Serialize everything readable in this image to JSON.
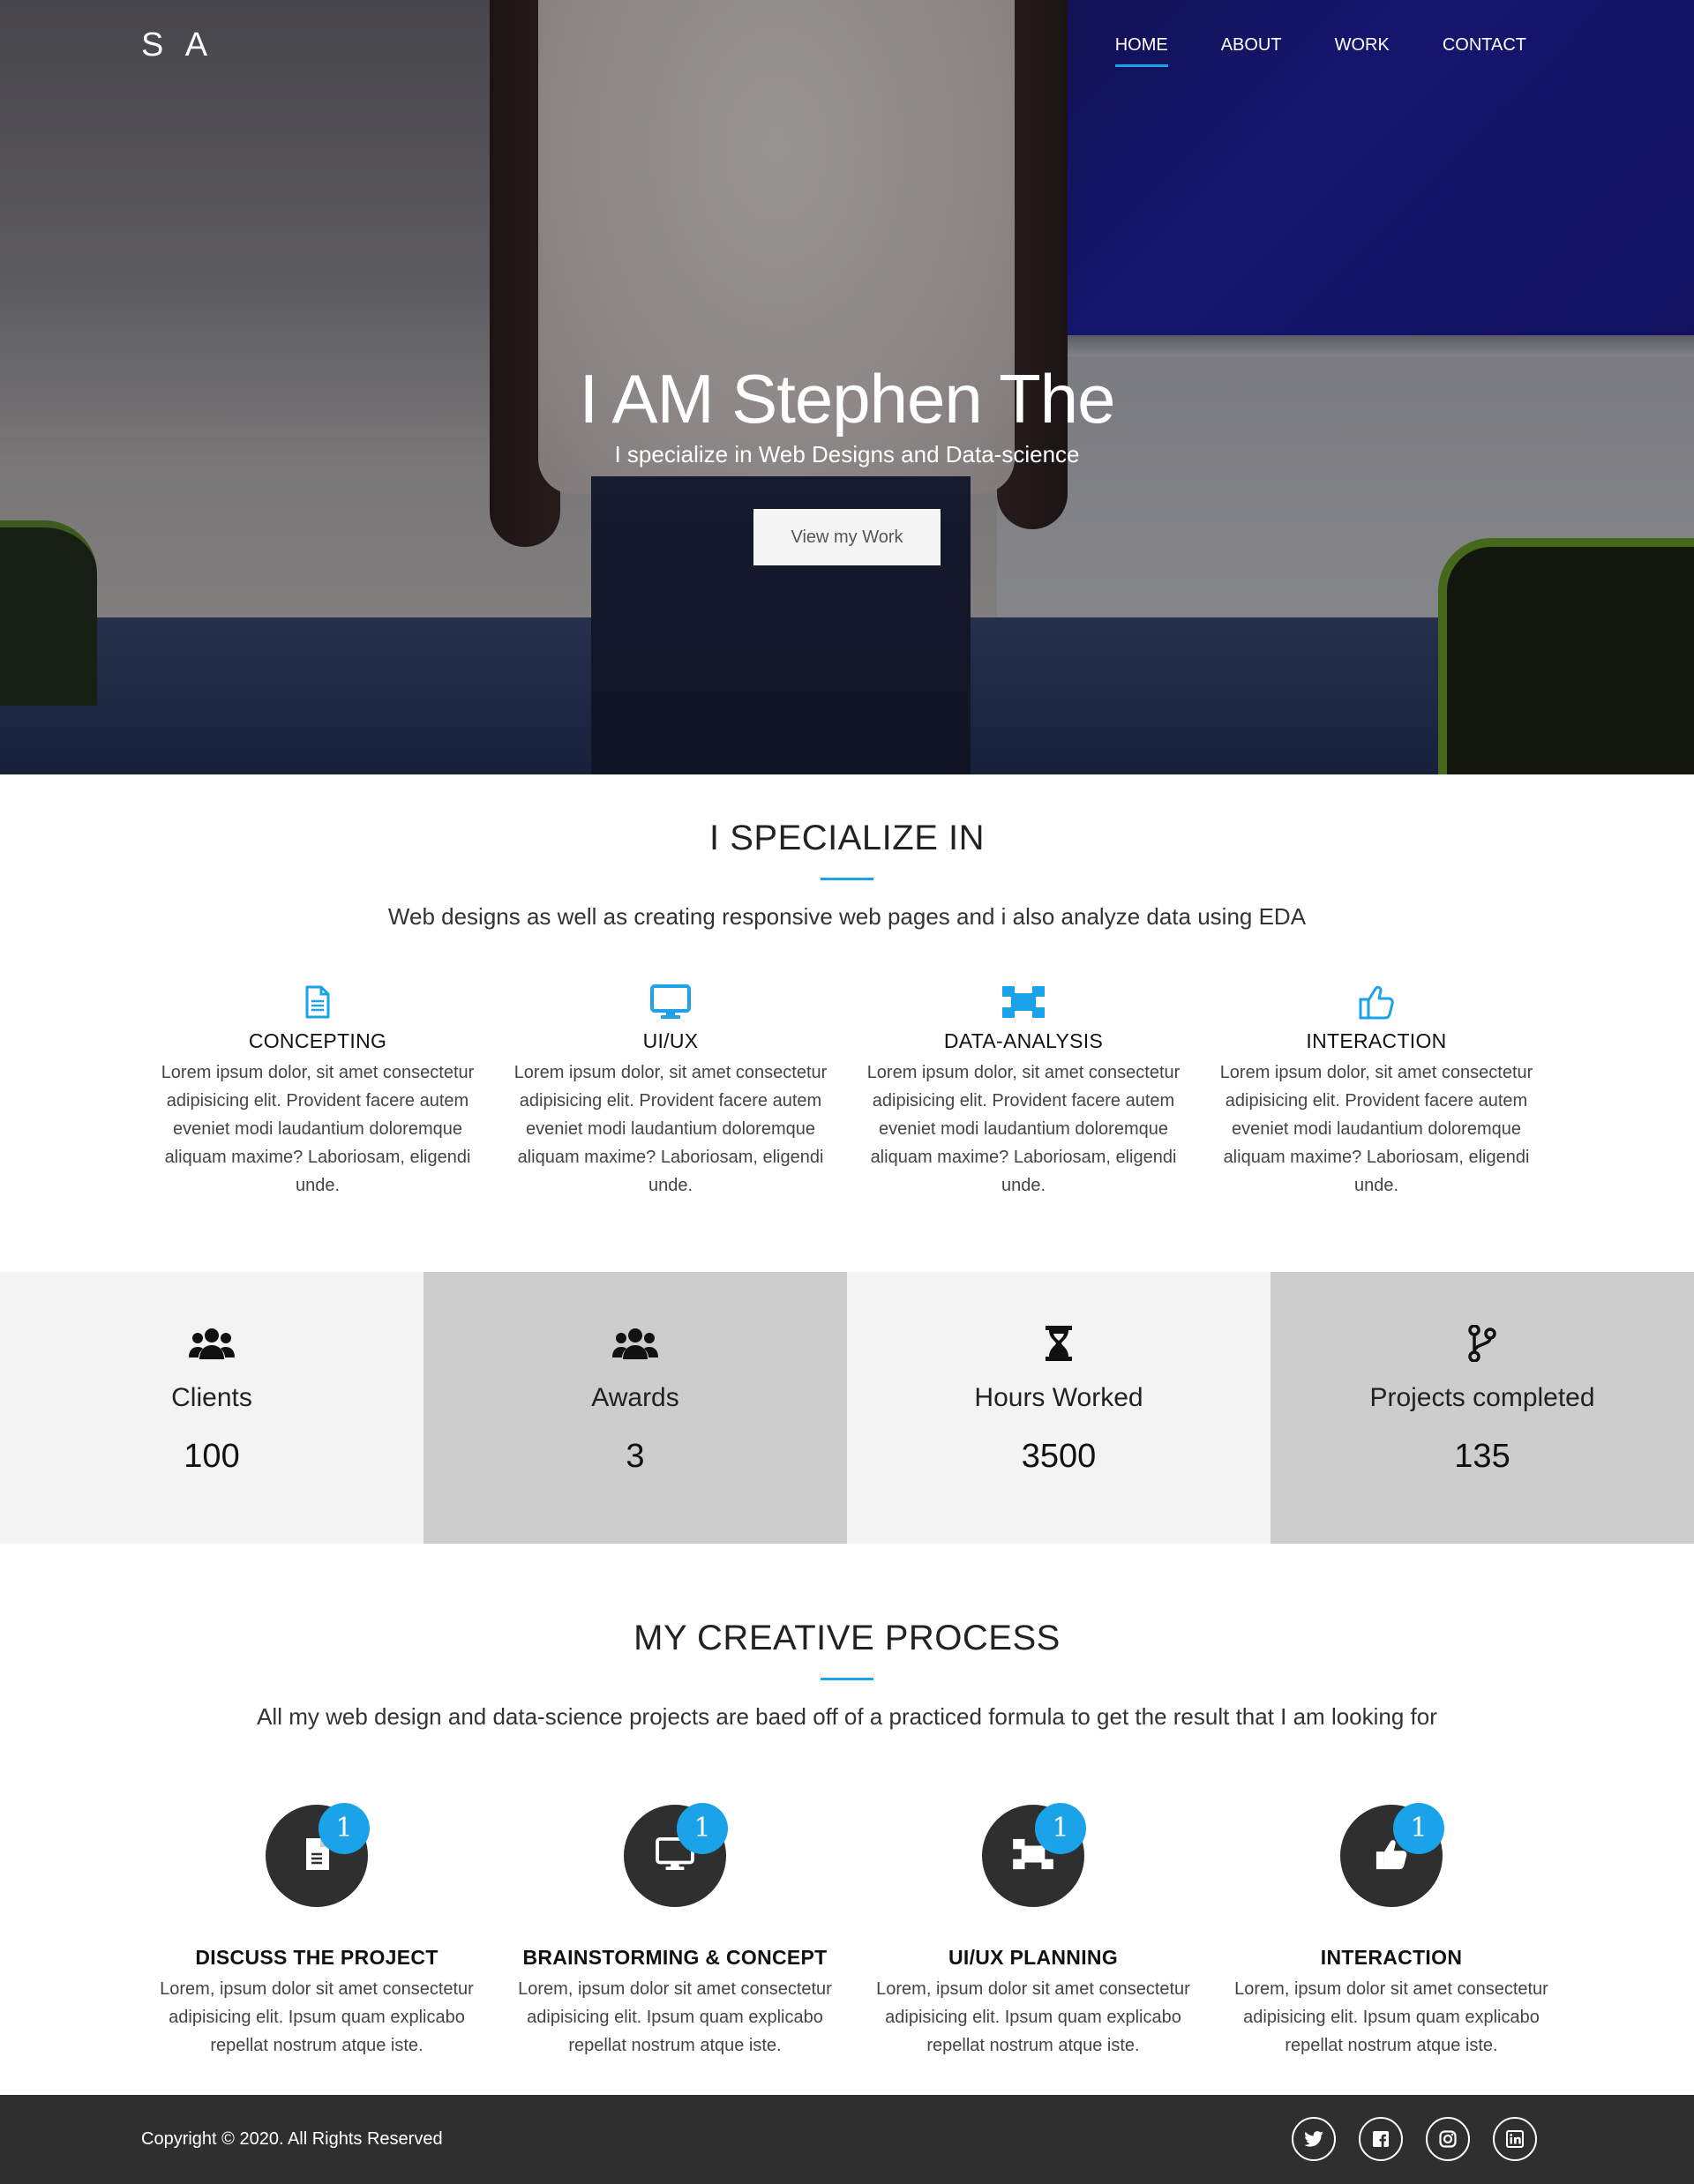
{
  "nav": {
    "logo": "S A",
    "items": [
      {
        "label": "HOME",
        "active": true
      },
      {
        "label": "ABOUT",
        "active": false
      },
      {
        "label": "WORK",
        "active": false
      },
      {
        "label": "CONTACT",
        "active": false
      }
    ]
  },
  "hero": {
    "title": "I AM Stephen The",
    "subtitle": "I specialize in Web Designs and Data-science",
    "button": "View my Work"
  },
  "specialize": {
    "title": "I SPECIALIZE IN",
    "subtitle": "Web designs as well as creating responsive web pages and i also analyze data using EDA",
    "items": [
      {
        "icon": "file-icon",
        "name": "CONCEPTING",
        "desc": "Lorem ipsum dolor, sit amet consectetur adipisicing elit. Provident facere autem eveniet modi laudantium doloremque aliquam maxime? Laboriosam, eligendi unde."
      },
      {
        "icon": "monitor-icon",
        "name": "UI/UX",
        "desc": "Lorem ipsum dolor, sit amet consectetur adipisicing elit. Provident facere autem eveniet modi laudantium doloremque aliquam maxime? Laboriosam, eligendi unde."
      },
      {
        "icon": "network-icon",
        "name": "DATA-ANALYSIS",
        "desc": "Lorem ipsum dolor, sit amet consectetur adipisicing elit. Provident facere autem eveniet modi laudantium doloremque aliquam maxime? Laboriosam, eligendi unde."
      },
      {
        "icon": "thumbs-up-icon",
        "name": "INTERACTION",
        "desc": "Lorem ipsum dolor, sit amet consectetur adipisicing elit. Provident facere autem eveniet modi laudantium doloremque aliquam maxime? Laboriosam, eligendi unde."
      }
    ]
  },
  "stats": [
    {
      "icon": "users-icon",
      "label": "Clients",
      "value": "100"
    },
    {
      "icon": "users-icon",
      "label": "Awards",
      "value": "3"
    },
    {
      "icon": "hourglass-icon",
      "label": "Hours Worked",
      "value": "3500"
    },
    {
      "icon": "code-branch-icon",
      "label": "Projects completed",
      "value": "135"
    }
  ],
  "process": {
    "title": "MY CREATIVE PROCESS",
    "subtitle": "All my web design and data-science projects are baed off of a practiced formula to get the result that I am looking for",
    "items": [
      {
        "icon": "file-icon",
        "badge": "1",
        "name": "DISCUSS THE PROJECT",
        "desc": "Lorem, ipsum dolor sit amet consectetur adipisicing elit. Ipsum quam explicabo repellat nostrum atque iste."
      },
      {
        "icon": "monitor-icon",
        "badge": "1",
        "name": "BRAINSTORMING & CONCEPT",
        "desc": "Lorem, ipsum dolor sit amet consectetur adipisicing elit. Ipsum quam explicabo repellat nostrum atque iste."
      },
      {
        "icon": "network-icon",
        "badge": "1",
        "name": "UI/UX PLANNING",
        "desc": "Lorem, ipsum dolor sit amet consectetur adipisicing elit. Ipsum quam explicabo repellat nostrum atque iste."
      },
      {
        "icon": "thumbs-up-icon",
        "badge": "1",
        "name": "INTERACTION",
        "desc": "Lorem, ipsum dolor sit amet consectetur adipisicing elit. Ipsum quam explicabo repellat nostrum atque iste."
      }
    ]
  },
  "footer": {
    "copyright": "Copyright © 2020. All Rights Reserved",
    "socials": [
      "twitter-icon",
      "facebook-icon",
      "instagram-icon",
      "linkedin-icon"
    ]
  },
  "colors": {
    "accent": "#1aa3e8",
    "dark": "#2f2f2f",
    "stat_light": "#f3f3f3",
    "stat_dark": "#cdcdcd"
  }
}
